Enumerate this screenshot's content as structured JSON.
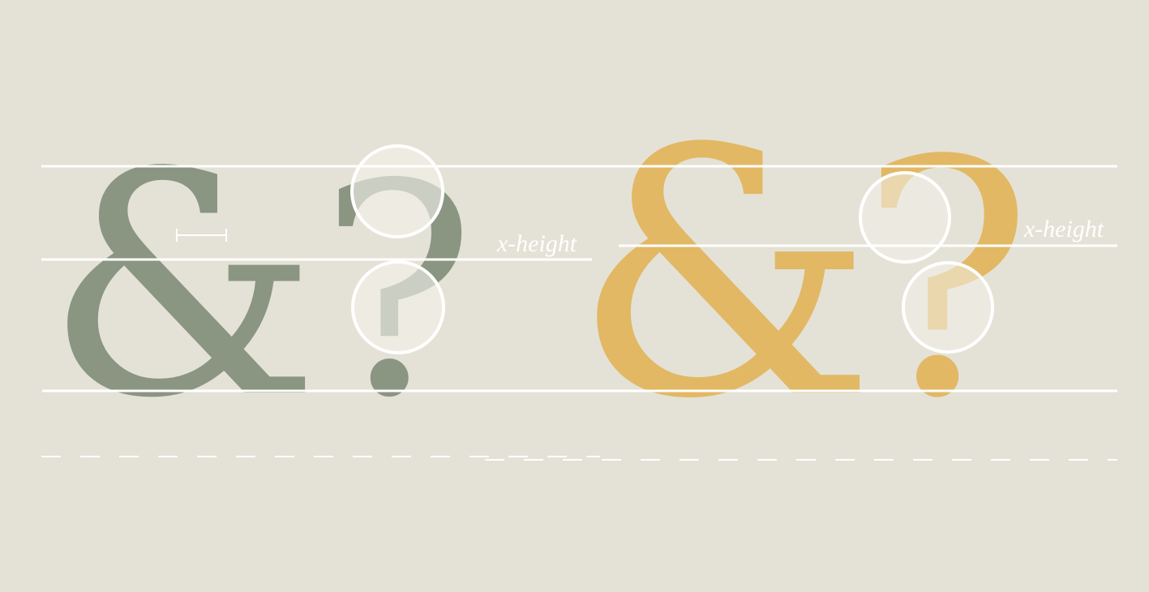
{
  "left_specimen": {
    "ampersand": "&",
    "question": "?",
    "xheight_label": "x-height"
  },
  "right_specimen": {
    "ampersand": "&",
    "question": "?",
    "xheight_label": "x-height"
  },
  "colors": {
    "background": "#e4e2d6",
    "guide": "#ffffff",
    "left_glyph": "#8a9582",
    "right_glyph": "#e2b864",
    "lens_fill": "#f3f1ea"
  }
}
